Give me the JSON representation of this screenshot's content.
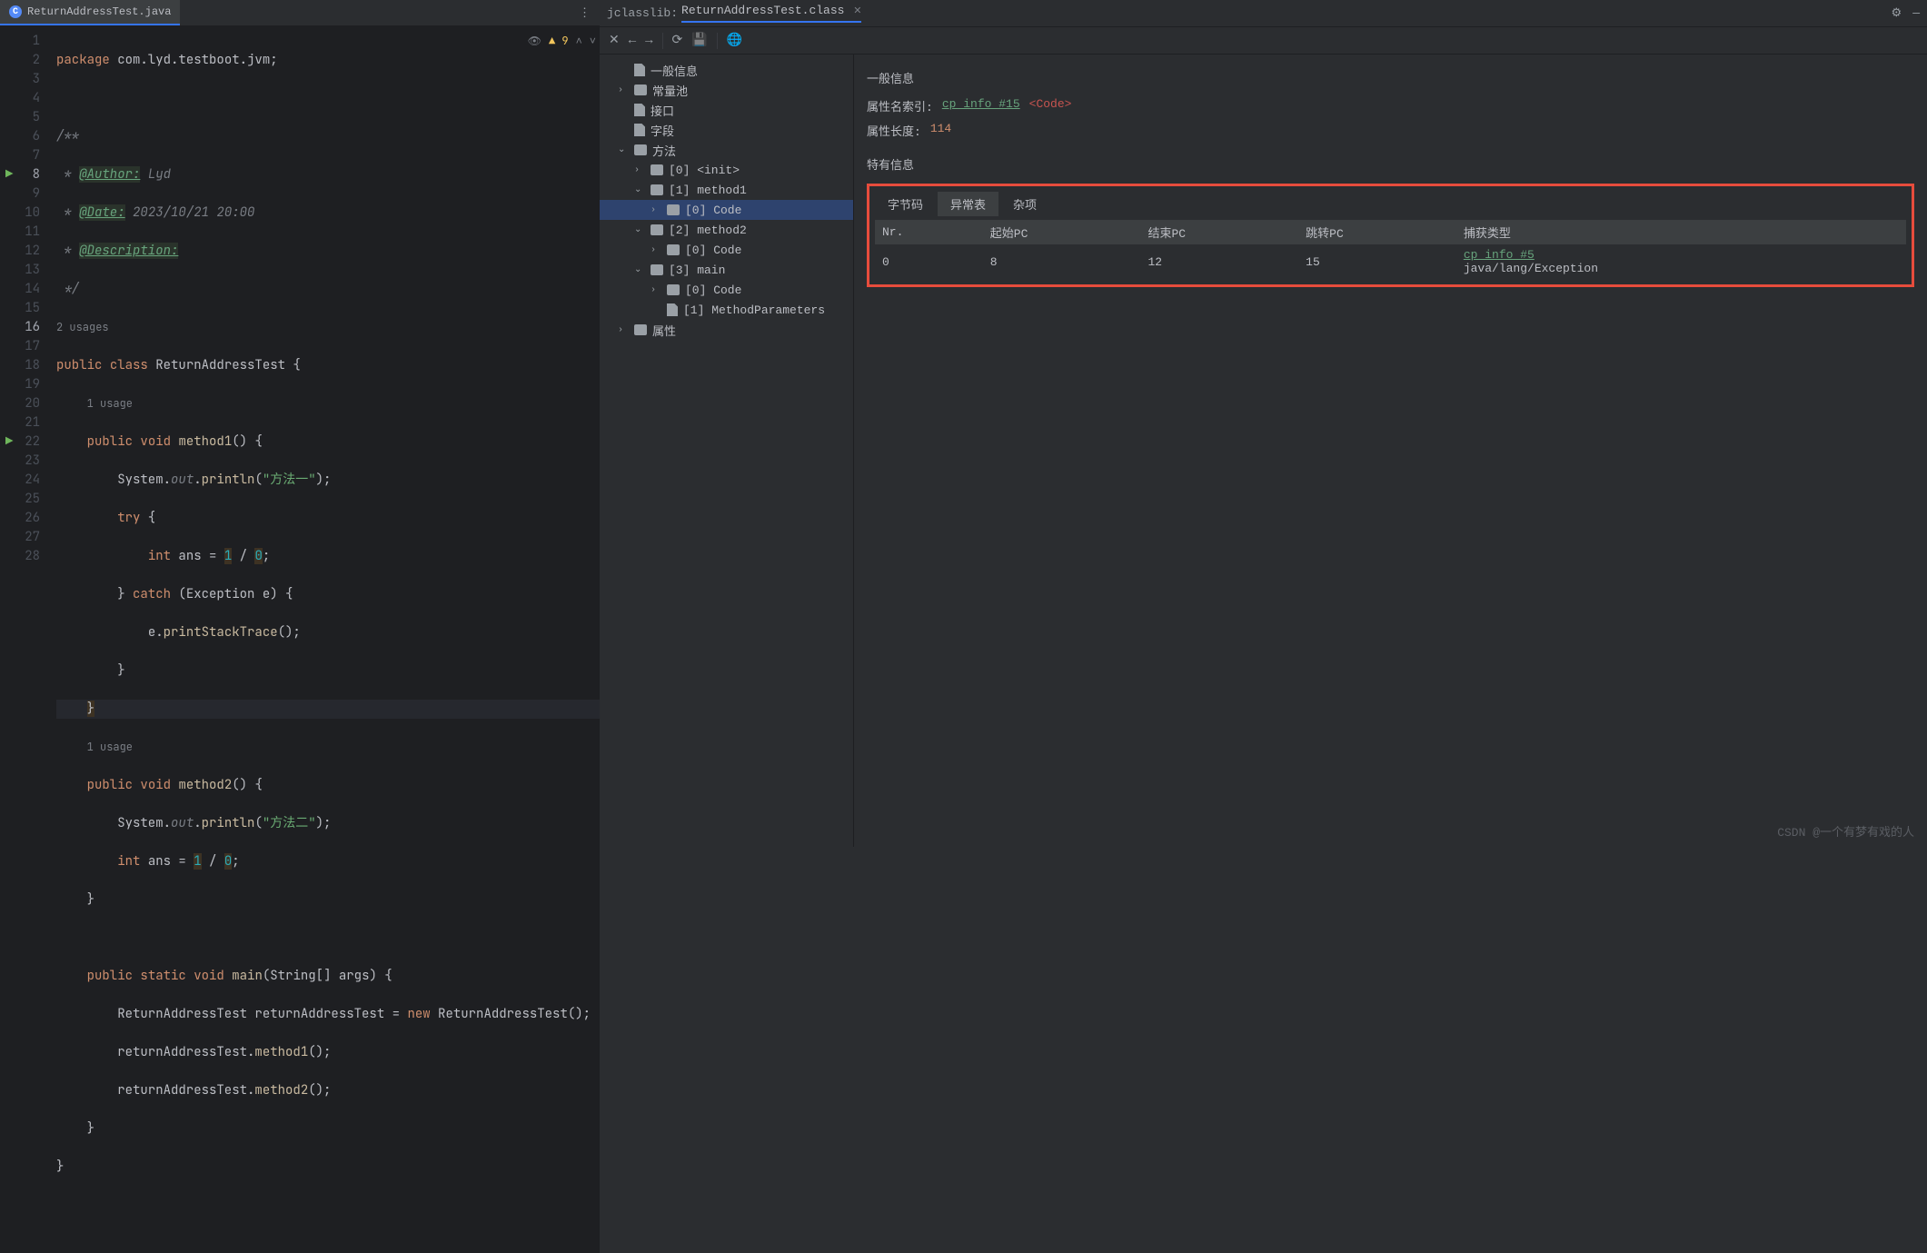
{
  "tabs": {
    "file_name": "ReturnAddressTest.java"
  },
  "indicators": {
    "warn_count": "9"
  },
  "code": {
    "package": "package",
    "pkg_path": "com.lyd.testboot.jvm",
    "doc_start": "/**",
    "author_tag": "@Author:",
    "author": "Lyd",
    "date_tag": "@Date:",
    "date": "2023/10/21 20:00",
    "desc_tag": "@Description:",
    "doc_end": " */",
    "usages2": "2 usages",
    "usage1": "1 usage",
    "public": "public",
    "class": "class",
    "class_name": "ReturnAddressTest",
    "void": "void",
    "m1": "method1",
    "m2": "method2",
    "system": "System",
    "out": "out",
    "println": "println",
    "s1": "\"方法一\"",
    "s2": "\"方法二\"",
    "try": "try",
    "int": "int",
    "ans": "ans",
    "eq": "=",
    "one": "1",
    "slash": "/",
    "zero": "0",
    "catch": "catch",
    "exc": "Exception",
    "e": "e",
    "pst": "printStackTrace",
    "static": "static",
    "main": "main",
    "string_arr": "String[]",
    "args": "args",
    "new": "new",
    "var": "returnAddressTest"
  },
  "right": {
    "label": "jclasslib:",
    "tab": "ReturnAddressTest.class",
    "tree": {
      "general": "一般信息",
      "constpool": "常量池",
      "iface": "接口",
      "fields": "字段",
      "methods": "方法",
      "m0": "[0] <init>",
      "m1": "[1] method1",
      "c0": "[0] Code",
      "m2": "[2] method2",
      "m3": "[3] main",
      "mp": "[1] MethodParameters",
      "attrs": "属性"
    },
    "detail": {
      "h1": "一般信息",
      "attr_idx_k": "属性名索引:",
      "cp15": "cp_info #15",
      "code_tag": "<Code>",
      "attr_len_k": "属性长度:",
      "attr_len_v": "114",
      "h2": "特有信息",
      "tabs": {
        "bytecode": "字节码",
        "exctbl": "异常表",
        "misc": "杂项"
      },
      "cols": {
        "nr": "Nr.",
        "start": "起始PC",
        "end": "结束PC",
        "jump": "跳转PC",
        "catch": "捕获类型"
      },
      "row": {
        "nr": "0",
        "start": "8",
        "end": "12",
        "jump": "15",
        "cp5": "cp_info #5",
        "exc": "java/lang/Exception"
      }
    }
  },
  "watermark": "CSDN @一个有梦有戏的人"
}
